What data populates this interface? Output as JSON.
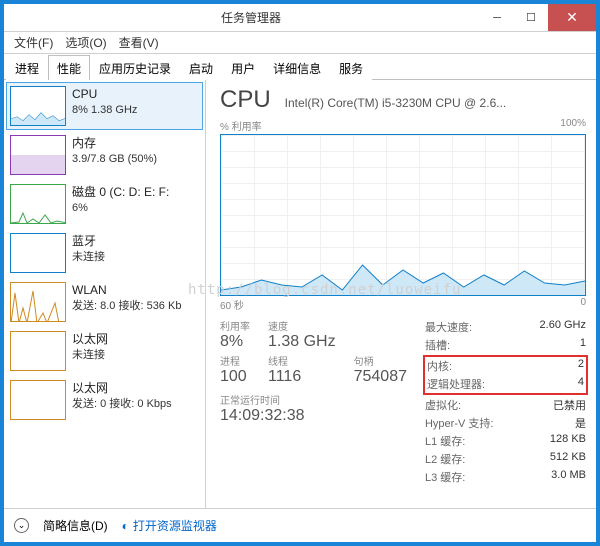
{
  "window": {
    "title": "任务管理器"
  },
  "menu": {
    "file": "文件(F)",
    "options": "选项(O)",
    "view": "查看(V)"
  },
  "tabs": [
    "进程",
    "性能",
    "应用历史记录",
    "启动",
    "用户",
    "详细信息",
    "服务"
  ],
  "sidebar": {
    "items": [
      {
        "name": "CPU",
        "sub": "8% 1.38 GHz",
        "color": "#1080c8"
      },
      {
        "name": "内存",
        "sub": "3.9/7.8 GB (50%)",
        "color": "#8a3ab8"
      },
      {
        "name": "磁盘 0 (C: D: E: F:",
        "sub": "6%",
        "color": "#3aa84a"
      },
      {
        "name": "蓝牙",
        "sub": "未连接",
        "color": "#1080c8"
      },
      {
        "name": "WLAN",
        "sub": "发送: 8.0 接收: 536 Kb",
        "color": "#d08a20"
      },
      {
        "name": "以太网",
        "sub": "未连接",
        "color": "#d08a20"
      },
      {
        "name": "以太网",
        "sub": "发送: 0 接收: 0 Kbps",
        "color": "#d08a20"
      }
    ]
  },
  "detail": {
    "title": "CPU",
    "model": "Intel(R) Core(TM) i5-3230M CPU @ 2.6...",
    "util_label": "% 利用率",
    "util_max": "100%",
    "time_label": "60 秒",
    "time_zero": "0",
    "stats": {
      "util_lbl": "利用率",
      "util": "8%",
      "speed_lbl": "速度",
      "speed": "1.38 GHz",
      "proc_lbl": "进程",
      "proc": "100",
      "thread_lbl": "线程",
      "thread": "1116",
      "handle_lbl": "句柄",
      "handle": "754087",
      "uptime_lbl": "正常运行时间",
      "uptime": "14:09:32:38"
    },
    "right": {
      "max_speed_k": "最大速度:",
      "max_speed_v": "2.60 GHz",
      "sockets_k": "插槽:",
      "sockets_v": "1",
      "cores_k": "内核:",
      "cores_v": "2",
      "logical_k": "逻辑处理器:",
      "logical_v": "4",
      "virt_k": "虚拟化:",
      "virt_v": "已禁用",
      "hyperv_k": "Hyper-V 支持:",
      "hyperv_v": "是",
      "l1_k": "L1 缓存:",
      "l1_v": "128 KB",
      "l2_k": "L2 缓存:",
      "l2_v": "512 KB",
      "l3_k": "L3 缓存:",
      "l3_v": "3.0 MB"
    }
  },
  "footer": {
    "fewer": "简略信息(D)",
    "resmon": "打开资源监视器"
  },
  "watermark": "http://blog.csdn.net/luoweifu",
  "chart_data": {
    "type": "line",
    "title": "% 利用率",
    "xlabel": "60 秒",
    "ylabel": "",
    "ylim": [
      0,
      100
    ],
    "xlim": [
      60,
      0
    ],
    "series": [
      {
        "name": "CPU",
        "x": [
          60,
          56,
          52,
          48,
          44,
          40,
          36,
          32,
          28,
          24,
          20,
          16,
          12,
          8,
          4,
          0
        ],
        "y": [
          3,
          4,
          8,
          6,
          5,
          10,
          4,
          14,
          6,
          12,
          8,
          10,
          5,
          9,
          6,
          7
        ]
      }
    ]
  }
}
